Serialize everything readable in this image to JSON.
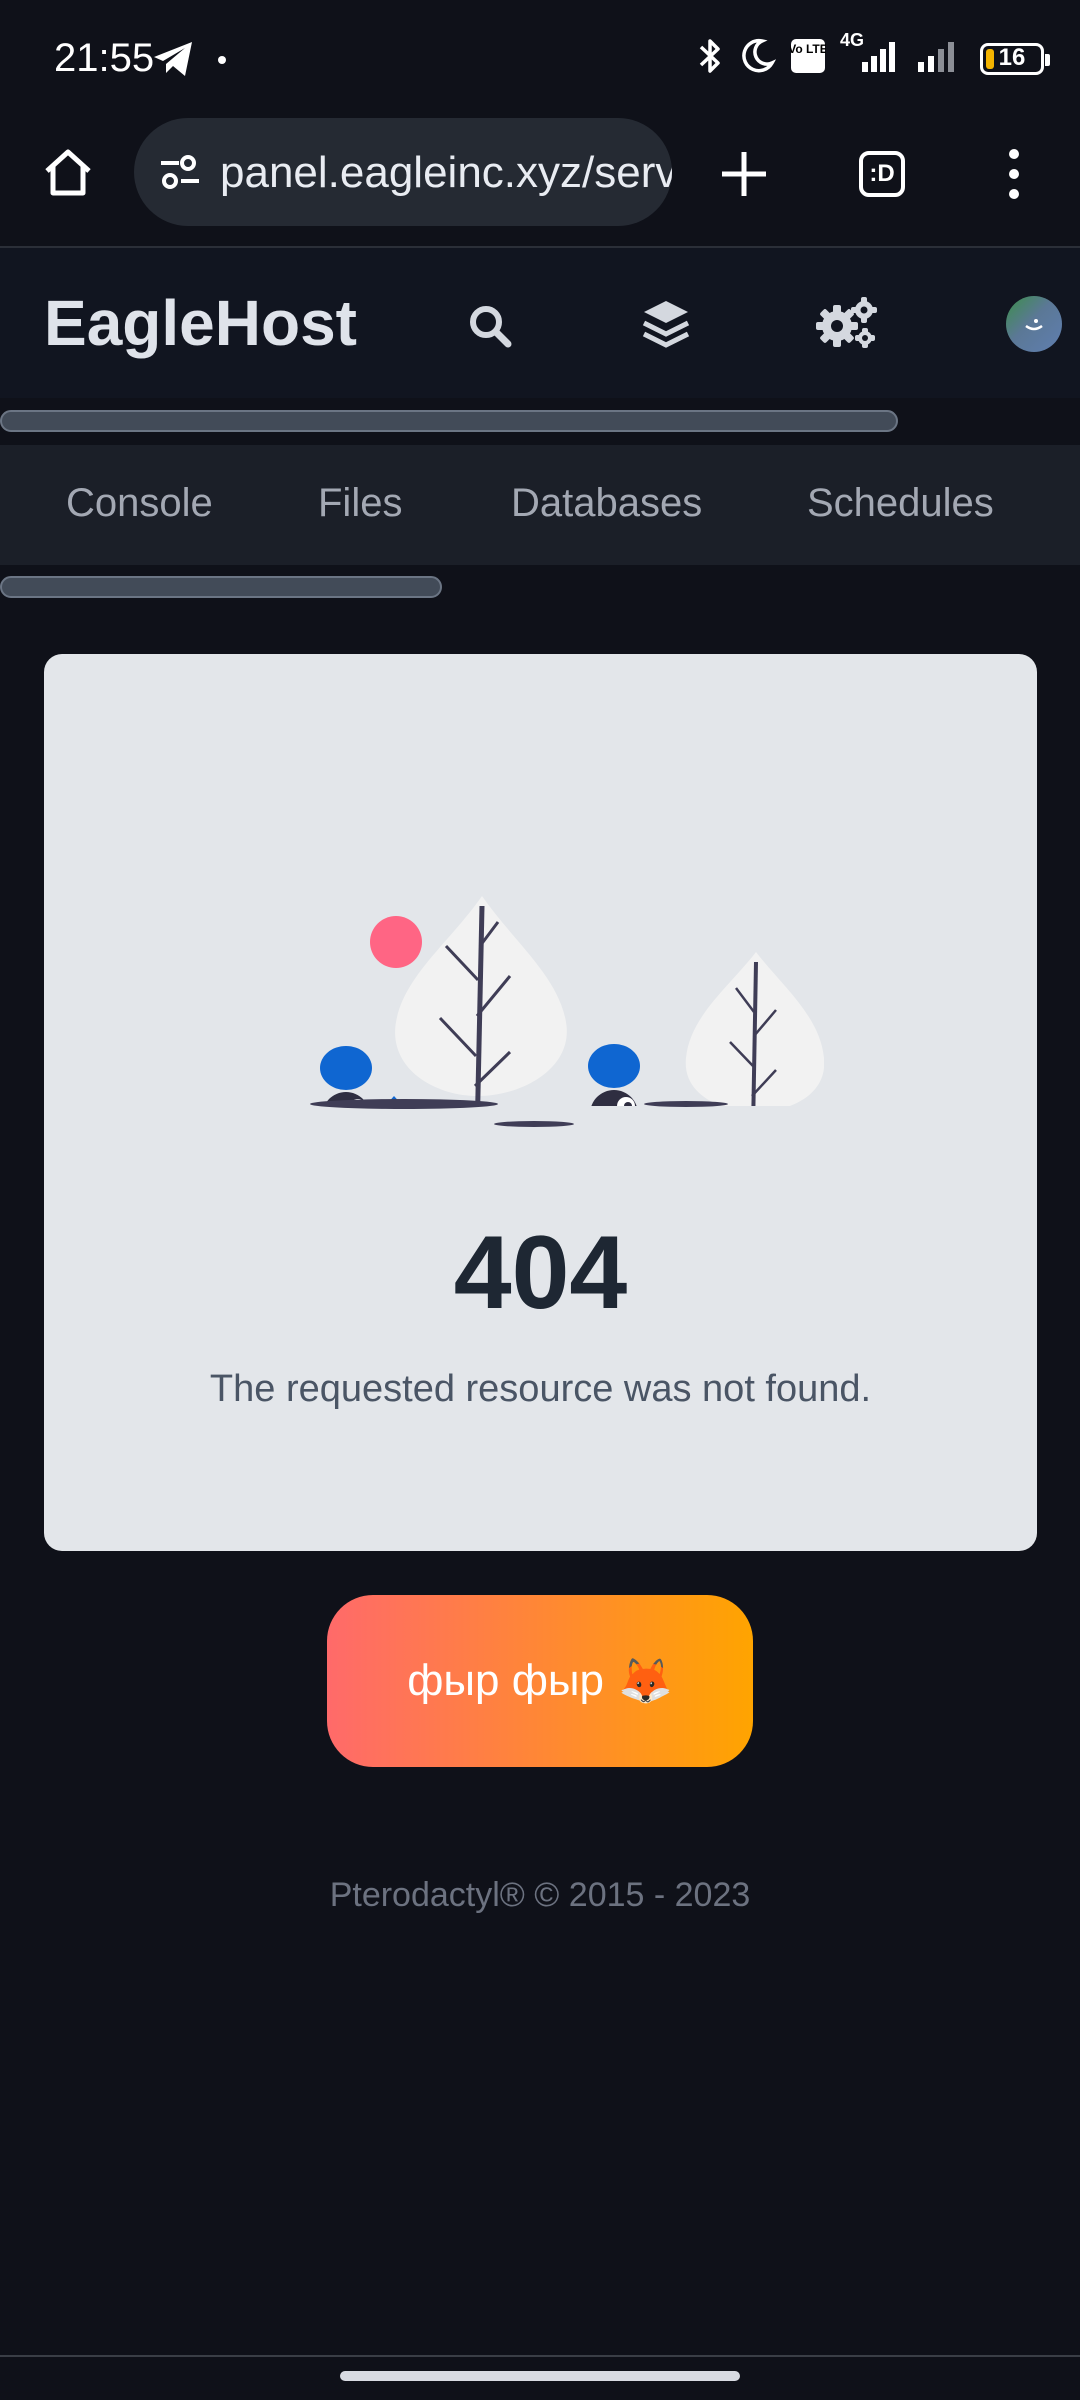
{
  "status_bar": {
    "time": "21:55",
    "network_type": "4G",
    "volte_badge": "Vo LTE",
    "battery": 16,
    "battery_text": "16",
    "icons": [
      "telegram-icon",
      "bluetooth-icon",
      "moon-icon",
      "volte-icon",
      "signal-icon",
      "battery-icon"
    ]
  },
  "browser": {
    "url": "panel.eagleinc.xyz/server",
    "tab_count_label": ":D",
    "icons": [
      "home-icon",
      "site-settings-icon",
      "new-tab-icon",
      "tabs-icon",
      "more-icon"
    ]
  },
  "header": {
    "brand": "EagleHost",
    "icons": [
      "search-icon",
      "layers-icon",
      "settings-icon",
      "avatar"
    ]
  },
  "sub_nav": {
    "tabs": [
      {
        "label": "Console"
      },
      {
        "label": "Files"
      },
      {
        "label": "Databases"
      },
      {
        "label": "Schedules"
      }
    ]
  },
  "error": {
    "code": "404",
    "message": "The requested resource was not found."
  },
  "action_button": {
    "label": "фыр фыр",
    "emoji": "🦊"
  },
  "footer": {
    "text": "Pterodactyl® © 2015 - 2023"
  },
  "colors": {
    "background": "#0f1119",
    "card": "#e3e6ea",
    "button_gradient_start": "#ff6a6a",
    "button_gradient_end": "#ffa400",
    "illustration_blue": "#0f66d1",
    "illustration_pink": "#ff6584"
  }
}
